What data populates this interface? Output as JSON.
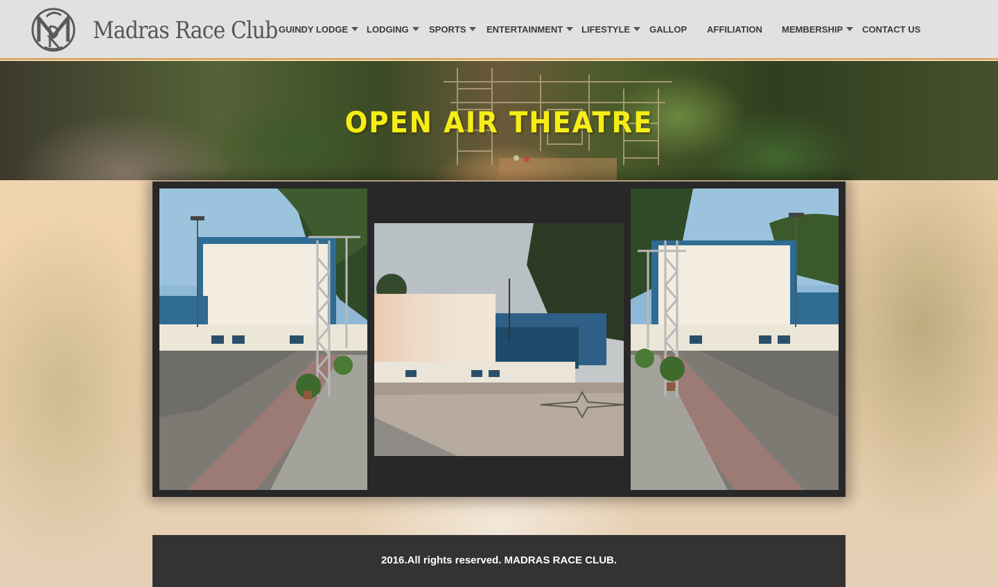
{
  "brand": {
    "name": "Madras Race Club",
    "monogram": "MRC monogram"
  },
  "nav": {
    "items": [
      {
        "label": "GUINDY LODGE",
        "dropdown": true
      },
      {
        "label": "LODGING",
        "dropdown": true
      },
      {
        "label": "SPORTS",
        "dropdown": true
      },
      {
        "label": "ENTERTAINMENT",
        "dropdown": true
      },
      {
        "label": "LIFESTYLE",
        "dropdown": true
      },
      {
        "label": "GALLOP",
        "dropdown": false
      },
      {
        "label": "AFFILIATION",
        "dropdown": false
      },
      {
        "label": "MEMBERSHIP",
        "dropdown": true
      },
      {
        "label": "CONTACT US",
        "dropdown": false
      }
    ]
  },
  "banner": {
    "title": "OPEN AIR THEATRE"
  },
  "gallery": {
    "photos": [
      {
        "name": "open-air-theatre-left-view"
      },
      {
        "name": "open-air-theatre-front-view"
      },
      {
        "name": "open-air-theatre-right-view"
      }
    ]
  },
  "footer": {
    "text": "2016.All rights reserved. MADRAS RACE CLUB."
  },
  "colors": {
    "header_bg": "#e2e0e0",
    "header_border": "#d49a3d",
    "banner_title": "#f5ee16",
    "gallery_bg": "#282828",
    "footer_bg": "#333333"
  }
}
